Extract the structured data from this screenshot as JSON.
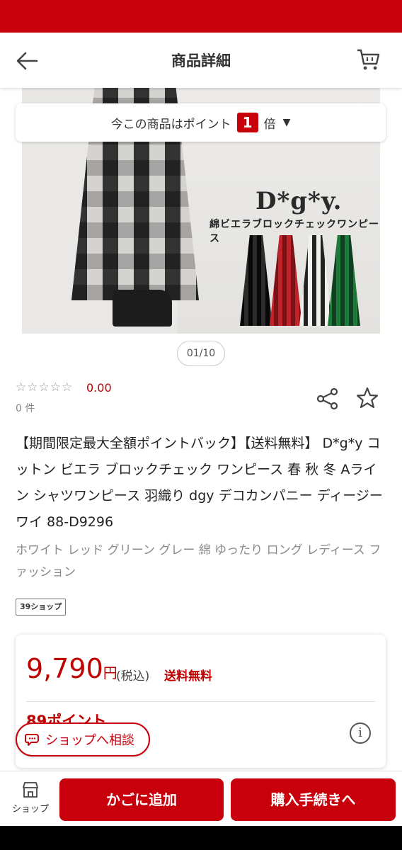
{
  "header": {
    "title": "商品詳細",
    "back_icon": "arrow-left-icon",
    "cart_icon": "cart-icon"
  },
  "colors": {
    "brand": "#c8000b",
    "price": "#bf0000",
    "muted": "#8a8a8a"
  },
  "points_banner": {
    "prefix": "今この商品はポイント",
    "multiplier": "1",
    "suffix": "倍",
    "caret": "▼"
  },
  "gallery": {
    "brand_logo": "D*g*y.",
    "subtitle": "綿ビエラブロックチェックワンピース",
    "pager": "01/10"
  },
  "rating": {
    "stars": "☆☆☆☆☆",
    "value": "0.00",
    "count": "0 件"
  },
  "product": {
    "title": "【期間限定最大全額ポイントバック】【送料無料】 D*g*y コットン ビエラ ブロックチェック ワンピース 春 秋 冬 Aライン シャツワンピース 羽織り dgy デコカンパニー ディージーワイ 88-D9296",
    "tags": "ホワイト レッド グリーン グレー 綿 ゆったり ロング レディース ファッション",
    "shop_badge": "39ショップ"
  },
  "price": {
    "amount": "9,790",
    "currency": "円",
    "tax": "(税込)",
    "shipping": "送料無料",
    "points": "89ポイント"
  },
  "consult": {
    "label": "ショップへ相談"
  },
  "bottom_bar": {
    "shop_label": "ショップ",
    "add_to_cart": "かごに追加",
    "purchase": "購入手続きへ"
  }
}
